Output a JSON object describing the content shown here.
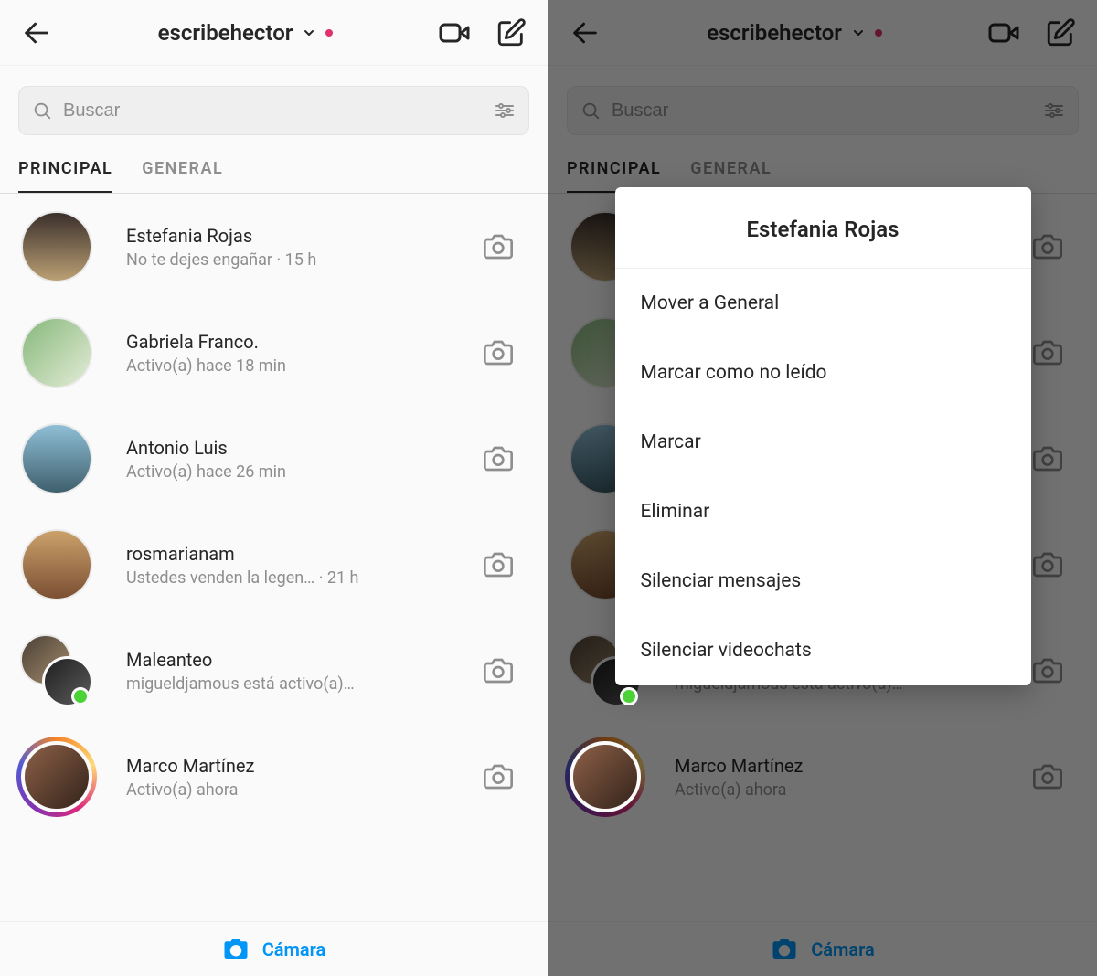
{
  "header": {
    "username": "escribehector"
  },
  "search": {
    "placeholder": "Buscar"
  },
  "tabs": {
    "principal": "PRINCIPAL",
    "general": "GENERAL"
  },
  "conversations": [
    {
      "name": "Estefania Rojas",
      "sub": "No te dejes engañar",
      "time": "15 h",
      "story": false,
      "group": false,
      "presence": false,
      "avatar_bg": "linear-gradient(180deg,#3a2f2b,#bba074)"
    },
    {
      "name": "Gabriela Franco.",
      "sub": "Activo(a) hace 18 min",
      "time": "",
      "story": false,
      "group": false,
      "presence": false,
      "avatar_bg": "linear-gradient(135deg,#86b87a,#e4ecd8)"
    },
    {
      "name": "Antonio Luis",
      "sub": "Activo(a) hace 26 min",
      "time": "",
      "story": false,
      "group": false,
      "presence": false,
      "avatar_bg": "linear-gradient(180deg,#8fbfd6,#3f5f6d)"
    },
    {
      "name": "rosmarianam",
      "sub": "Ustedes venden la legen…",
      "time": "21 h",
      "story": false,
      "group": false,
      "presence": false,
      "avatar_bg": "linear-gradient(180deg,#caa16a,#7b4f33)"
    },
    {
      "name": "Maleanteo",
      "sub": "migueldjamous está activo(a)…",
      "time": "",
      "story": false,
      "group": true,
      "presence": true,
      "avatar_bg_a": "linear-gradient(135deg,#4a4036,#a68d6d)",
      "avatar_bg_b": "linear-gradient(135deg,#1f1f1f,#5c5c5c)"
    },
    {
      "name": "Marco Martínez",
      "sub": "Activo(a) ahora",
      "time": "",
      "story": true,
      "group": false,
      "presence": false,
      "avatar_bg": "linear-gradient(135deg,#8d6048,#33231a)"
    }
  ],
  "bottom": {
    "camera": "Cámara"
  },
  "context_menu": {
    "title": "Estefania Rojas",
    "items": [
      "Mover a General",
      "Marcar como no leído",
      "Marcar",
      "Eliminar",
      "Silenciar mensajes",
      "Silenciar videochats"
    ]
  }
}
